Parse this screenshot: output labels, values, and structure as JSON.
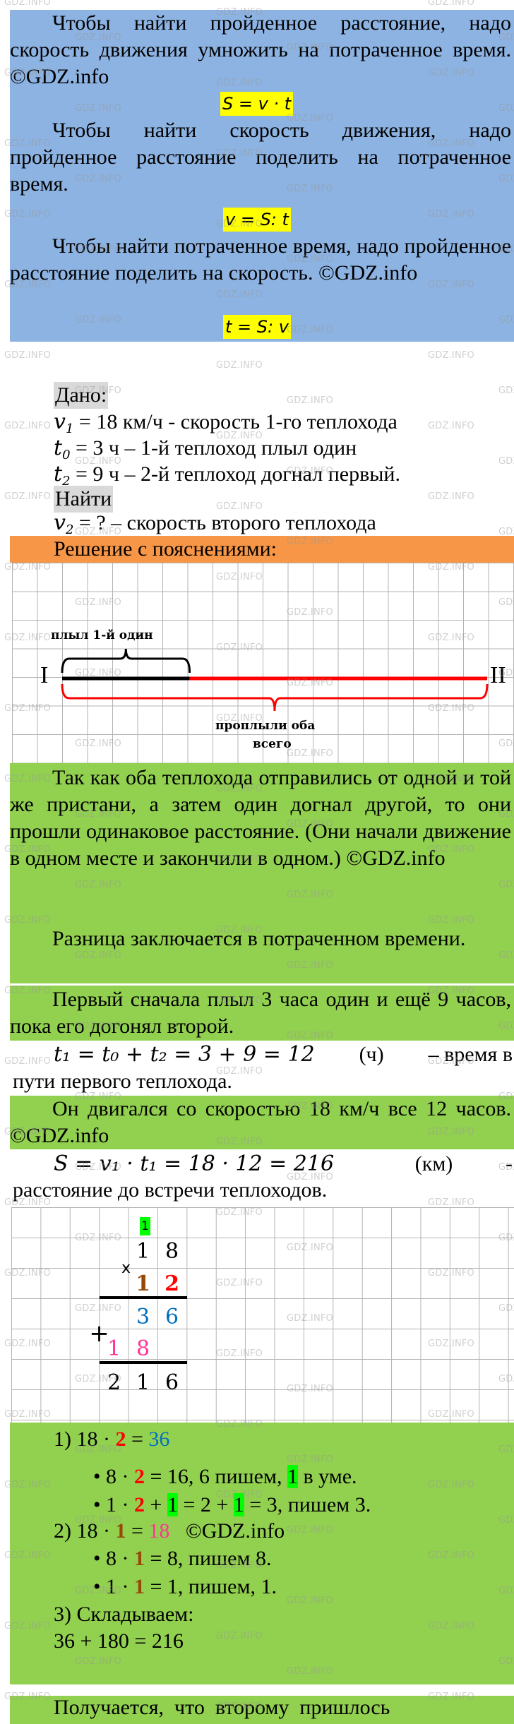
{
  "theory": {
    "p1": "Чтобы найти пройденное расстояние, надо скорость движения умножить на потраченное время. ©GDZ.info",
    "f1": "S = v · t",
    "p2": "Чтобы найти скорость движения, надо пройденное расстояние поделить на потраченное время.",
    "f2": "v = S: t",
    "p3": "Чтобы найти потраченное время, надо пройденное расстояние поделить на скорость. ©GDZ.info",
    "f3": "t = S: v"
  },
  "given": {
    "heading": "Дано:",
    "lines": [
      {
        "var": "v",
        "sub": "1",
        "rest": " = 18 км/ч  - скорость 1-го теплохода"
      },
      {
        "var": "t",
        "sub": "0",
        "rest": " = 3 ч – 1-й теплоход плыл один"
      },
      {
        "var": "t",
        "sub": "2",
        "rest": " = 9 ч – 2-й теплоход догнал первый."
      }
    ],
    "find_heading": "Найти",
    "find": {
      "var": "v",
      "sub": "2",
      "rest": " = ? – скорость второго теплохода"
    }
  },
  "solution_heading": "Решение с пояснениями:",
  "diagram": {
    "label_start": "I",
    "label_end": "II",
    "top_brace_label": "плыл 1-й один",
    "bottom_brace_label_1": "проплыли оба",
    "bottom_brace_label_2": "всего",
    "first_segment_fraction": 0.3,
    "colors": {
      "first_segment": "#000000",
      "rest_segment": "#ff0000",
      "bottom_brace": "#ff0000"
    }
  },
  "explanation": {
    "p1": "Так как оба теплохода отправились от одной и той же пристани, а затем один догнал другой, то они прошли одинаковое расстояние. (Они начали движение в одном месте и закончили в одном.) ©GDZ.info",
    "p2": "Разница заключается в потраченном времени.",
    "p3": "Первый сначала плыл 3 часа один и ещё 9 часов, пока его догонял второй.",
    "calc1_formula": "t₁ = t₀ + t₂ = 3 + 9 = 12",
    "calc1_unit": "(ч)",
    "calc1_text_a": "–  время  в",
    "calc1_text_b": "пути первого теплохода.",
    "p4": "Он двигался со скоростью 18 км/ч все 12 часов.  ©GDZ.info",
    "calc2_formula": "S = v₁ · t₁ = 18 · 12 = 216",
    "calc2_unit": "(км)",
    "calc2_dash": "-",
    "calc2_text": "расстояние до встречи теплоходов."
  },
  "column_multiplication": {
    "carry": "1",
    "multiplicand": [
      "1",
      "8"
    ],
    "sign_multiply": "x",
    "multiplier": [
      "1",
      "2"
    ],
    "partial1": [
      "3",
      "6"
    ],
    "sign_add": "+",
    "partial2": [
      "1",
      "8"
    ],
    "result": [
      "2",
      "1",
      "6"
    ]
  },
  "steps": {
    "s1": {
      "pre": "1) 18 · ",
      "factor": "2",
      "mid": " = ",
      "result": "36"
    },
    "s1a": {
      "pre": "8 · ",
      "factor": "2",
      "mid": " = 16, 6 пишем, ",
      "carry": "1",
      "post": " в уме."
    },
    "s1b": {
      "pre": "1 · ",
      "factor": "2",
      "mid": " + ",
      "carry1": "1",
      "mid2": " = 2 + ",
      "carry2": "1",
      "post": " = 3, пишем 3."
    },
    "s2": {
      "pre": "2) 18 · ",
      "factor": "1",
      "mid": " = ",
      "result": "18",
      "post": "   ©GDZ.info"
    },
    "s2a": {
      "pre": "8 · ",
      "factor": "1",
      "post": " = 8, пишем 8."
    },
    "s2b": {
      "pre": "1 · ",
      "factor": "1",
      "post": " = 1, пишем, 1."
    },
    "s3": "3) Складываем:",
    "s3calc": "36 + 180 = 216"
  },
  "conclusion_start": "Получается,  что  второму  пришлось",
  "watermark": "GDZ.INFO"
}
